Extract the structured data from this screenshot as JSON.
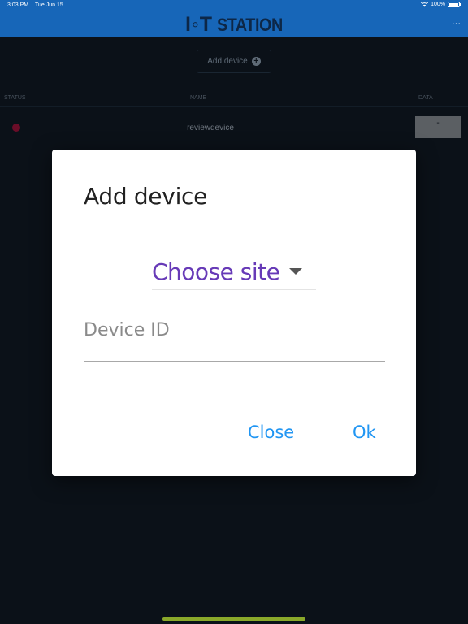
{
  "status_bar": {
    "time": "3:03 PM",
    "date": "Tue Jun 15",
    "battery": "100%"
  },
  "header": {
    "logo_io": "I◦T",
    "logo_station": "STATION",
    "more": "···"
  },
  "toolbar": {
    "add_device_label": "Add device",
    "add_icon": "+"
  },
  "table": {
    "columns": [
      "STATUS",
      "NAME",
      "DATA"
    ],
    "rows": [
      {
        "status_color": "#6b0d28",
        "name": "reviewdevice",
        "data": "-"
      }
    ]
  },
  "dialog": {
    "title": "Add device",
    "site_select_label": "Choose site",
    "device_id_placeholder": "Device ID",
    "close_label": "Close",
    "ok_label": "Ok"
  },
  "colors": {
    "brand": "#1766b8",
    "accent_purple": "#673ab7",
    "accent_blue": "#2196f3"
  }
}
